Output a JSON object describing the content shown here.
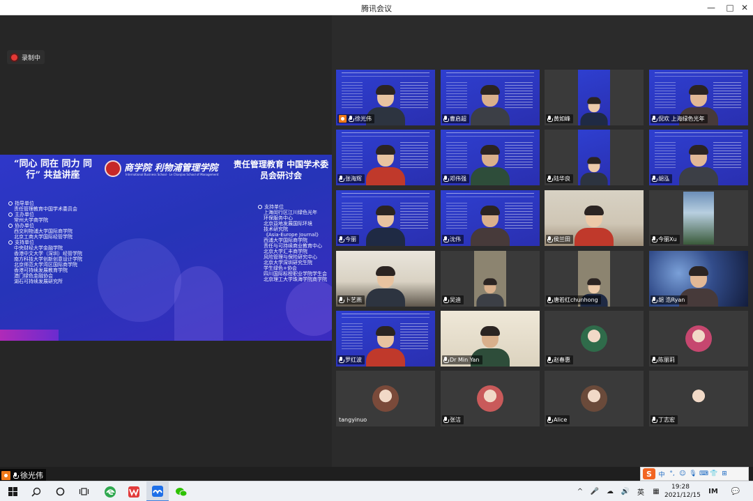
{
  "window": {
    "title": "腾讯会议",
    "controls": {
      "minimize": "—",
      "maximize": "□",
      "close": "✕"
    }
  },
  "recording": {
    "label": "录制中"
  },
  "slide": {
    "title_left": "“同心 同在 同力 同行” 共益讲座",
    "school_name": "商学院 利物浦管理学院",
    "school_name_en": "International Business School · Le Chanjiao School of Management",
    "title_right": "责任管理教育 中国学术委员会研讨会",
    "left_sections": [
      {
        "head": "指导单位",
        "items": [
          "责任管理教育中国学术委员会"
        ]
      },
      {
        "head": "主办单位",
        "items": [
          "常州大学商学院"
        ]
      },
      {
        "head": "协办单位",
        "items": [
          "西交利物浦大学国际商学院",
          "北京工商大学国际经管学院"
        ]
      },
      {
        "head": "支持单位",
        "items": [
          "中央财经大学金融学院",
          "香港中文大学（深圳）经管学院",
          "南方科技大学创新创意设计学院",
          "北京师范大学湾区国际商学院",
          "香港可持续发展教育学院",
          "澳门绿色金融协会",
          "湖石可持续发展研究所"
        ]
      }
    ],
    "right_sections": [
      {
        "head": "支持单位",
        "items": [
          "上海闵行区江川绿色光年",
          "环保服务中心",
          "北京益地发展国际环境",
          "技术研究院",
          "《Asia-Europe Journal》",
          "西浦大学国际商学院",
          "责任与可持续商业教育中心",
          "北京大学汇丰商学院",
          "风险管理与保险研究中心",
          "北京大学深圳研究生院",
          "学生绿色+协会",
          "四川国际标榜职业学院学生会",
          "北京理工大学珠海学院商学院"
        ]
      }
    ]
  },
  "participants": [
    {
      "name": "徐光伟",
      "host": true,
      "mic": true
    },
    {
      "name": "曹启超",
      "host": false,
      "mic": true
    },
    {
      "name": "黄如峰",
      "host": false,
      "mic": true
    },
    {
      "name": "倪欢 上海绿色光年",
      "host": false,
      "mic": true
    },
    {
      "name": "张海辉",
      "host": false,
      "mic": true
    },
    {
      "name": "邓伟强",
      "host": false,
      "mic": true
    },
    {
      "name": "陆华良",
      "host": false,
      "mic": true
    },
    {
      "name": "胡泓",
      "host": false,
      "mic": true
    },
    {
      "name": "今丽",
      "host": false,
      "mic": true
    },
    {
      "name": "沈伟",
      "host": false,
      "mic": true
    },
    {
      "name": "侯兰田",
      "host": false,
      "mic": true
    },
    {
      "name": "今丽Xu",
      "host": false,
      "mic": true
    },
    {
      "name": "卜艺燕",
      "host": false,
      "mic": true
    },
    {
      "name": "吴迪",
      "host": false,
      "mic": true
    },
    {
      "name": "唐若红chunhong",
      "host": false,
      "mic": true
    },
    {
      "name": "胡 浩Ryan",
      "host": false,
      "mic": true
    },
    {
      "name": "罗红波",
      "host": false,
      "mic": true
    },
    {
      "name": "Dr Min Yan",
      "host": false,
      "mic": true
    },
    {
      "name": "赵春惠",
      "host": false,
      "mic": true
    },
    {
      "name": "陈丽莉",
      "host": false,
      "mic": true
    },
    {
      "name": "tangyinuo",
      "host": false,
      "mic": false
    },
    {
      "name": "张洁",
      "host": false,
      "mic": true
    },
    {
      "name": "Alice",
      "host": false,
      "mic": true
    },
    {
      "name": "丁志宏",
      "host": false,
      "mic": true
    }
  ],
  "active_speaker": {
    "name": "徐光伟"
  },
  "ime": {
    "logo": "S",
    "mode": "中",
    "items": [
      "°,",
      "☺",
      "🎙",
      "⌨",
      "👕",
      "⊞"
    ]
  },
  "taskbar": {
    "clock_time": "19:28",
    "clock_date": "2021/12/15",
    "tray_icons": [
      "^",
      "🎤",
      "☁",
      "🔊",
      "英",
      "▦",
      "IM",
      "💬"
    ]
  },
  "colors": {
    "accent_host": "#f07a1a",
    "record": "#e53935",
    "slide_blue": "#2f37c9"
  }
}
